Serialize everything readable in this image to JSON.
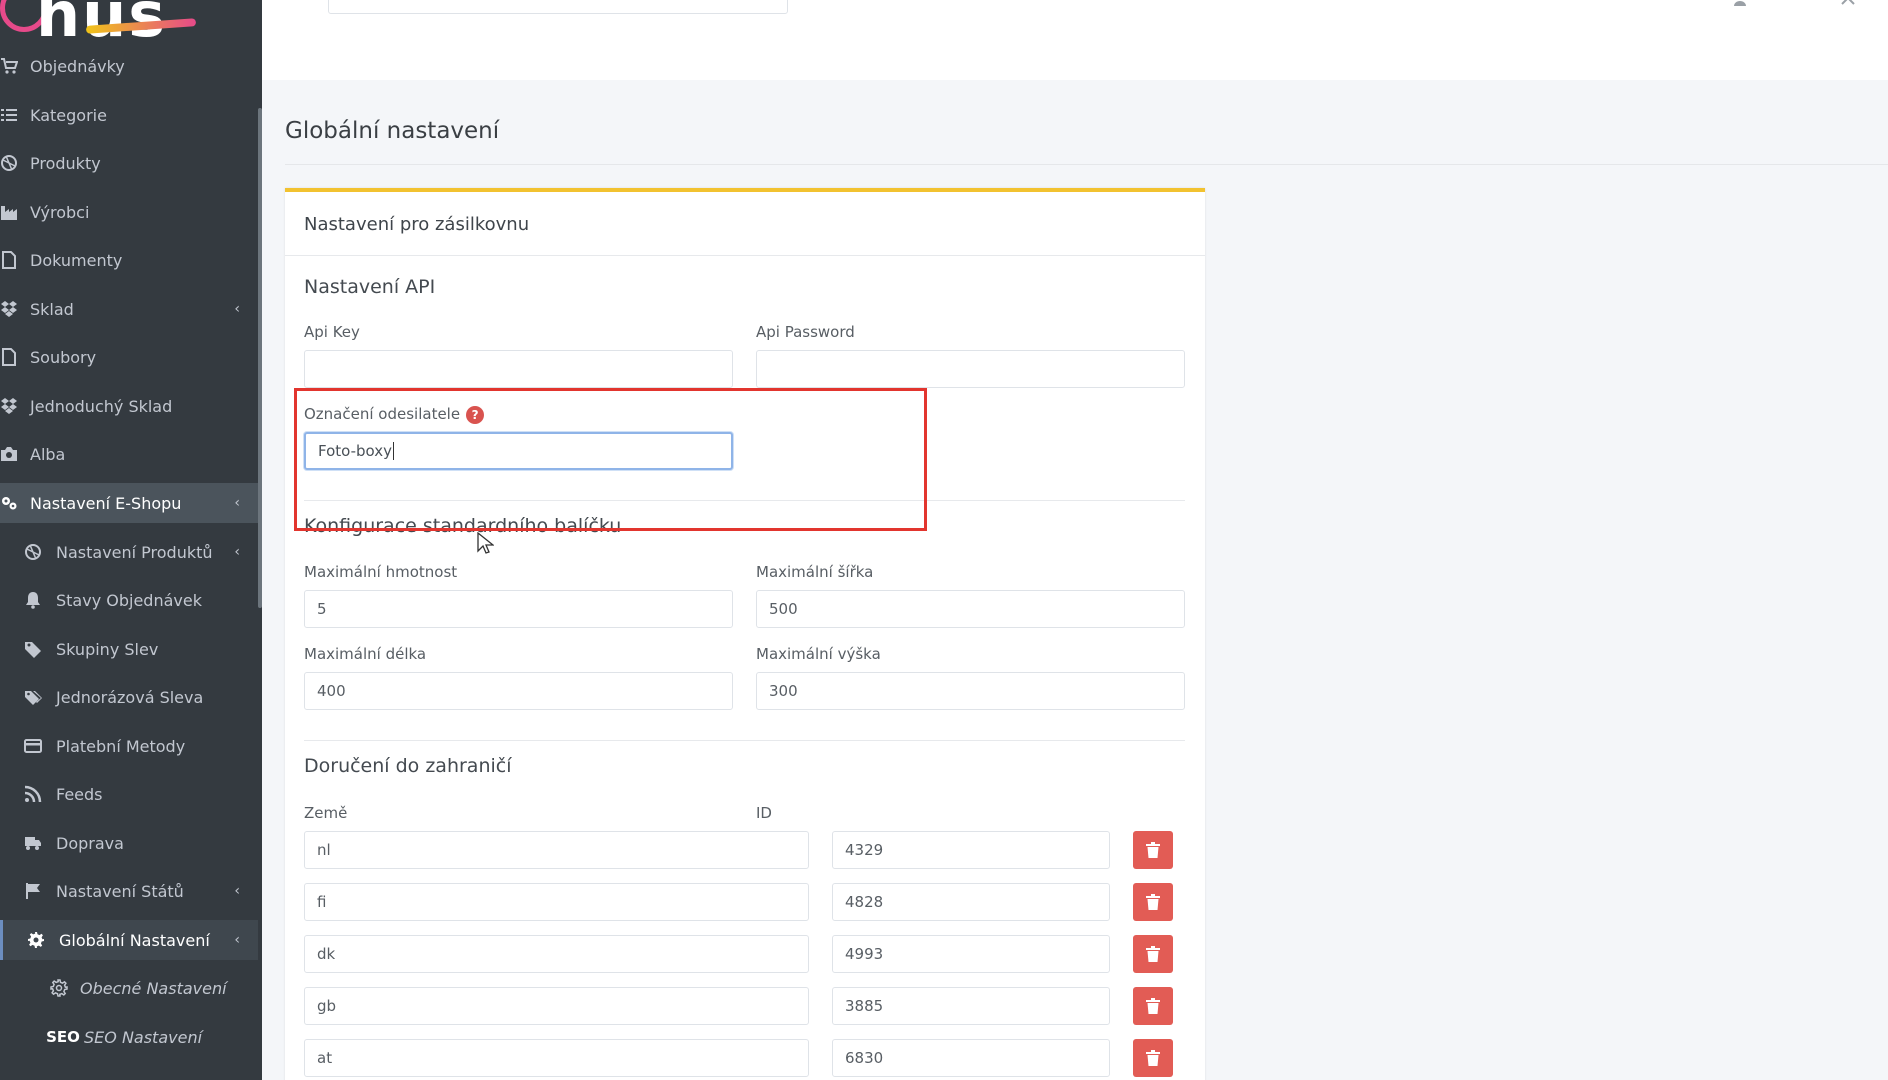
{
  "sidebar": {
    "logo_text": "hus",
    "items": [
      {
        "label": "Objednávky",
        "icon": "cart-icon"
      },
      {
        "label": "Kategorie",
        "icon": "list-icon"
      },
      {
        "label": "Produkty",
        "icon": "ball-icon"
      },
      {
        "label": "Výrobci",
        "icon": "factory-icon"
      },
      {
        "label": "Dokumenty",
        "icon": "file-icon"
      },
      {
        "label": "Sklad",
        "icon": "dropbox-icon",
        "chevron": "‹"
      },
      {
        "label": "Soubory",
        "icon": "file-icon"
      },
      {
        "label": "Jednoduchý Sklad",
        "icon": "dropbox-icon"
      },
      {
        "label": "Alba",
        "icon": "camera-icon"
      },
      {
        "label": "Nastavení E-Shopu",
        "icon": "gears-icon",
        "chevron": "‹"
      },
      {
        "label": "Nastavení Produktů",
        "icon": "ball-icon",
        "chevron": "‹"
      },
      {
        "label": "Stavy Objednávek",
        "icon": "bell-icon"
      },
      {
        "label": "Skupiny Slev",
        "icon": "tag-icon"
      },
      {
        "label": "Jednorázová Sleva",
        "icon": "tags-icon"
      },
      {
        "label": "Platební Metody",
        "icon": "credit-card-icon"
      },
      {
        "label": "Feeds",
        "icon": "rss-icon"
      },
      {
        "label": "Doprava",
        "icon": "truck-icon"
      },
      {
        "label": "Nastavení Států",
        "icon": "flag-icon",
        "chevron": "‹"
      },
      {
        "label": "Globální Nastavení",
        "icon": "gear-icon",
        "chevron": "‹"
      },
      {
        "label": "Obecné Nastavení",
        "icon": "cog-icon"
      },
      {
        "label": "SEO Nastavení",
        "icon": "seo-icon",
        "icon_text": "SEO"
      }
    ]
  },
  "page": {
    "title": "Globální nastavení"
  },
  "card": {
    "header": "Nastavení pro zásilkovnu",
    "api_section": {
      "title": "Nastavení API",
      "api_key_label": "Api Key",
      "api_key_value": "",
      "api_password_label": "Api Password",
      "api_password_value": "",
      "sender_label": "Označení odesilatele",
      "sender_help": "?",
      "sender_value": "Foto-boxy"
    },
    "package_section": {
      "title": "Konfigurace standardního balíčku",
      "max_weight_label": "Maximální hmotnost",
      "max_weight_value": "5",
      "max_width_label": "Maximální šířka",
      "max_width_value": "500",
      "max_length_label": "Maximální délka",
      "max_length_value": "400",
      "max_height_label": "Maximální výška",
      "max_height_value": "300"
    },
    "abroad_section": {
      "title": "Doručení do zahraničí",
      "country_label": "Země",
      "id_label": "ID",
      "rows": [
        {
          "country": "nl",
          "id": "4329"
        },
        {
          "country": "fi",
          "id": "4828"
        },
        {
          "country": "dk",
          "id": "4993"
        },
        {
          "country": "gb",
          "id": "3885"
        },
        {
          "country": "at",
          "id": "6830"
        }
      ]
    }
  },
  "colors": {
    "sidebar_bg": "#343a40",
    "card_accent": "#f2c230",
    "delete_button": "#e25c55",
    "highlight": "#e2352e"
  }
}
